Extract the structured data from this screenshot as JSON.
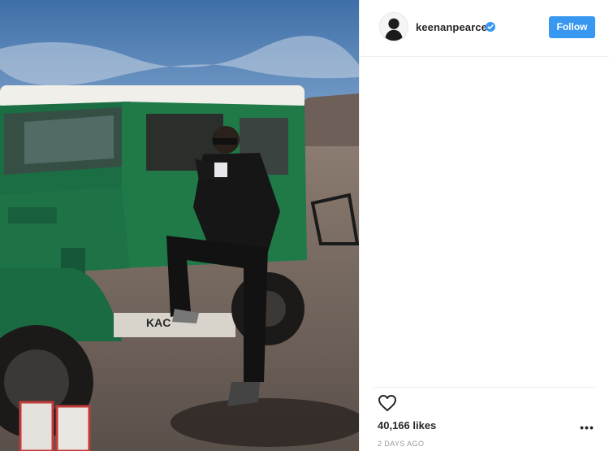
{
  "post": {
    "username": "keenanpearce",
    "follow_label": "Follow",
    "likes": "40,166 likes",
    "time": "2 DAYS AGO",
    "more_glyph": "•••"
  },
  "icons": {
    "verified": "verified-badge-icon",
    "heart": "heart-icon",
    "more": "more-options-icon"
  },
  "colors": {
    "accent": "#3897f0",
    "text": "#262626",
    "muted": "#999999",
    "jeep": "#1f7a48"
  }
}
